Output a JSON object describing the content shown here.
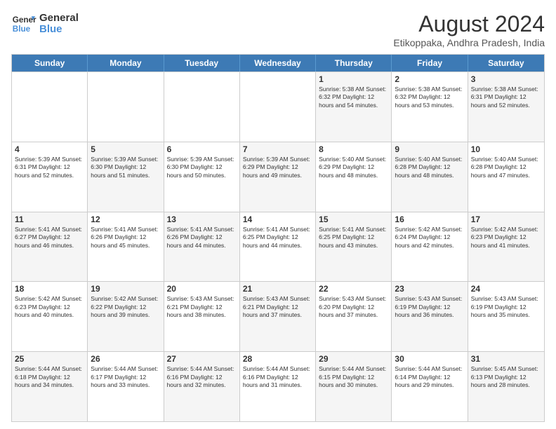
{
  "header": {
    "logo_line1": "General",
    "logo_line2": "Blue",
    "title": "August 2024",
    "subtitle": "Etikoppaka, Andhra Pradesh, India"
  },
  "days_of_week": [
    "Sunday",
    "Monday",
    "Tuesday",
    "Wednesday",
    "Thursday",
    "Friday",
    "Saturday"
  ],
  "rows": [
    [
      {
        "day": "",
        "info": "",
        "shaded": false
      },
      {
        "day": "",
        "info": "",
        "shaded": false
      },
      {
        "day": "",
        "info": "",
        "shaded": false
      },
      {
        "day": "",
        "info": "",
        "shaded": false
      },
      {
        "day": "1",
        "info": "Sunrise: 5:38 AM\nSunset: 6:32 PM\nDaylight: 12 hours\nand 54 minutes.",
        "shaded": true
      },
      {
        "day": "2",
        "info": "Sunrise: 5:38 AM\nSunset: 6:32 PM\nDaylight: 12 hours\nand 53 minutes.",
        "shaded": false
      },
      {
        "day": "3",
        "info": "Sunrise: 5:38 AM\nSunset: 6:31 PM\nDaylight: 12 hours\nand 52 minutes.",
        "shaded": true
      }
    ],
    [
      {
        "day": "4",
        "info": "Sunrise: 5:39 AM\nSunset: 6:31 PM\nDaylight: 12 hours\nand 52 minutes.",
        "shaded": false
      },
      {
        "day": "5",
        "info": "Sunrise: 5:39 AM\nSunset: 6:30 PM\nDaylight: 12 hours\nand 51 minutes.",
        "shaded": true
      },
      {
        "day": "6",
        "info": "Sunrise: 5:39 AM\nSunset: 6:30 PM\nDaylight: 12 hours\nand 50 minutes.",
        "shaded": false
      },
      {
        "day": "7",
        "info": "Sunrise: 5:39 AM\nSunset: 6:29 PM\nDaylight: 12 hours\nand 49 minutes.",
        "shaded": true
      },
      {
        "day": "8",
        "info": "Sunrise: 5:40 AM\nSunset: 6:29 PM\nDaylight: 12 hours\nand 48 minutes.",
        "shaded": false
      },
      {
        "day": "9",
        "info": "Sunrise: 5:40 AM\nSunset: 6:28 PM\nDaylight: 12 hours\nand 48 minutes.",
        "shaded": true
      },
      {
        "day": "10",
        "info": "Sunrise: 5:40 AM\nSunset: 6:28 PM\nDaylight: 12 hours\nand 47 minutes.",
        "shaded": false
      }
    ],
    [
      {
        "day": "11",
        "info": "Sunrise: 5:41 AM\nSunset: 6:27 PM\nDaylight: 12 hours\nand 46 minutes.",
        "shaded": true
      },
      {
        "day": "12",
        "info": "Sunrise: 5:41 AM\nSunset: 6:26 PM\nDaylight: 12 hours\nand 45 minutes.",
        "shaded": false
      },
      {
        "day": "13",
        "info": "Sunrise: 5:41 AM\nSunset: 6:26 PM\nDaylight: 12 hours\nand 44 minutes.",
        "shaded": true
      },
      {
        "day": "14",
        "info": "Sunrise: 5:41 AM\nSunset: 6:25 PM\nDaylight: 12 hours\nand 44 minutes.",
        "shaded": false
      },
      {
        "day": "15",
        "info": "Sunrise: 5:41 AM\nSunset: 6:25 PM\nDaylight: 12 hours\nand 43 minutes.",
        "shaded": true
      },
      {
        "day": "16",
        "info": "Sunrise: 5:42 AM\nSunset: 6:24 PM\nDaylight: 12 hours\nand 42 minutes.",
        "shaded": false
      },
      {
        "day": "17",
        "info": "Sunrise: 5:42 AM\nSunset: 6:23 PM\nDaylight: 12 hours\nand 41 minutes.",
        "shaded": true
      }
    ],
    [
      {
        "day": "18",
        "info": "Sunrise: 5:42 AM\nSunset: 6:23 PM\nDaylight: 12 hours\nand 40 minutes.",
        "shaded": false
      },
      {
        "day": "19",
        "info": "Sunrise: 5:42 AM\nSunset: 6:22 PM\nDaylight: 12 hours\nand 39 minutes.",
        "shaded": true
      },
      {
        "day": "20",
        "info": "Sunrise: 5:43 AM\nSunset: 6:21 PM\nDaylight: 12 hours\nand 38 minutes.",
        "shaded": false
      },
      {
        "day": "21",
        "info": "Sunrise: 5:43 AM\nSunset: 6:21 PM\nDaylight: 12 hours\nand 37 minutes.",
        "shaded": true
      },
      {
        "day": "22",
        "info": "Sunrise: 5:43 AM\nSunset: 6:20 PM\nDaylight: 12 hours\nand 37 minutes.",
        "shaded": false
      },
      {
        "day": "23",
        "info": "Sunrise: 5:43 AM\nSunset: 6:19 PM\nDaylight: 12 hours\nand 36 minutes.",
        "shaded": true
      },
      {
        "day": "24",
        "info": "Sunrise: 5:43 AM\nSunset: 6:19 PM\nDaylight: 12 hours\nand 35 minutes.",
        "shaded": false
      }
    ],
    [
      {
        "day": "25",
        "info": "Sunrise: 5:44 AM\nSunset: 6:18 PM\nDaylight: 12 hours\nand 34 minutes.",
        "shaded": true
      },
      {
        "day": "26",
        "info": "Sunrise: 5:44 AM\nSunset: 6:17 PM\nDaylight: 12 hours\nand 33 minutes.",
        "shaded": false
      },
      {
        "day": "27",
        "info": "Sunrise: 5:44 AM\nSunset: 6:16 PM\nDaylight: 12 hours\nand 32 minutes.",
        "shaded": true
      },
      {
        "day": "28",
        "info": "Sunrise: 5:44 AM\nSunset: 6:16 PM\nDaylight: 12 hours\nand 31 minutes.",
        "shaded": false
      },
      {
        "day": "29",
        "info": "Sunrise: 5:44 AM\nSunset: 6:15 PM\nDaylight: 12 hours\nand 30 minutes.",
        "shaded": true
      },
      {
        "day": "30",
        "info": "Sunrise: 5:44 AM\nSunset: 6:14 PM\nDaylight: 12 hours\nand 29 minutes.",
        "shaded": false
      },
      {
        "day": "31",
        "info": "Sunrise: 5:45 AM\nSunset: 6:13 PM\nDaylight: 12 hours\nand 28 minutes.",
        "shaded": true
      }
    ]
  ]
}
